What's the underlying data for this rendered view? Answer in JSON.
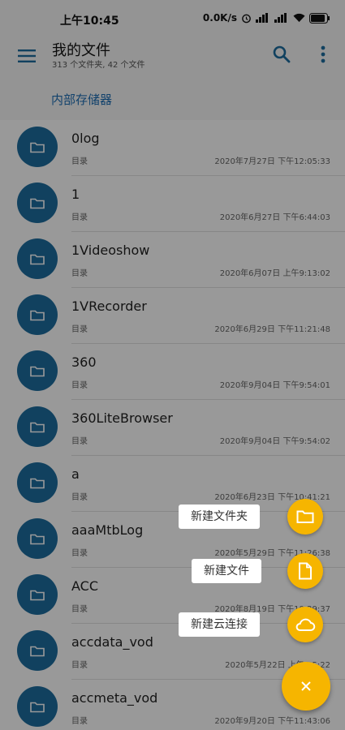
{
  "status_bar": {
    "time": "上午10:45",
    "net_speed": "0.0K/s",
    "battery": "85"
  },
  "app_bar": {
    "title": "我的文件",
    "subtitle": "313 个文件夹, 42 个文件"
  },
  "breadcrumb": "内部存储器",
  "files": [
    {
      "name": "0log",
      "type": "目录",
      "date": "2020年7月27日 下午12:05:33"
    },
    {
      "name": "1",
      "type": "目录",
      "date": "2020年6月27日 下午6:44:03"
    },
    {
      "name": "1Videoshow",
      "type": "目录",
      "date": "2020年6月07日 上午9:13:02"
    },
    {
      "name": "1VRecorder",
      "type": "目录",
      "date": "2020年6月29日 下午11:21:48"
    },
    {
      "name": "360",
      "type": "目录",
      "date": "2020年9月04日 下午9:54:01"
    },
    {
      "name": "360LiteBrowser",
      "type": "目录",
      "date": "2020年9月04日 下午9:54:02"
    },
    {
      "name": "a",
      "type": "目录",
      "date": "2020年6月23日 下午10:41:21"
    },
    {
      "name": "aaaMtbLog",
      "type": "目录",
      "date": "2020年5月29日 下午11:26:38"
    },
    {
      "name": "ACC",
      "type": "目录",
      "date": "2020年8月19日 下午10:29:37"
    },
    {
      "name": "accdata_vod",
      "type": "目录",
      "date": "2020年5月22日 上午9:5:22"
    },
    {
      "name": "accmeta_vod",
      "type": "目录",
      "date": "2020年9月20日 下午11:43:06"
    }
  ],
  "fab_menu": {
    "new_folder": "新建文件夹",
    "new_file": "新建文件",
    "new_cloud": "新建云连接"
  },
  "colors": {
    "folder_circle": "#1d6d9f",
    "fab": "#f6b500",
    "accent_text": "#1f6fb5"
  }
}
